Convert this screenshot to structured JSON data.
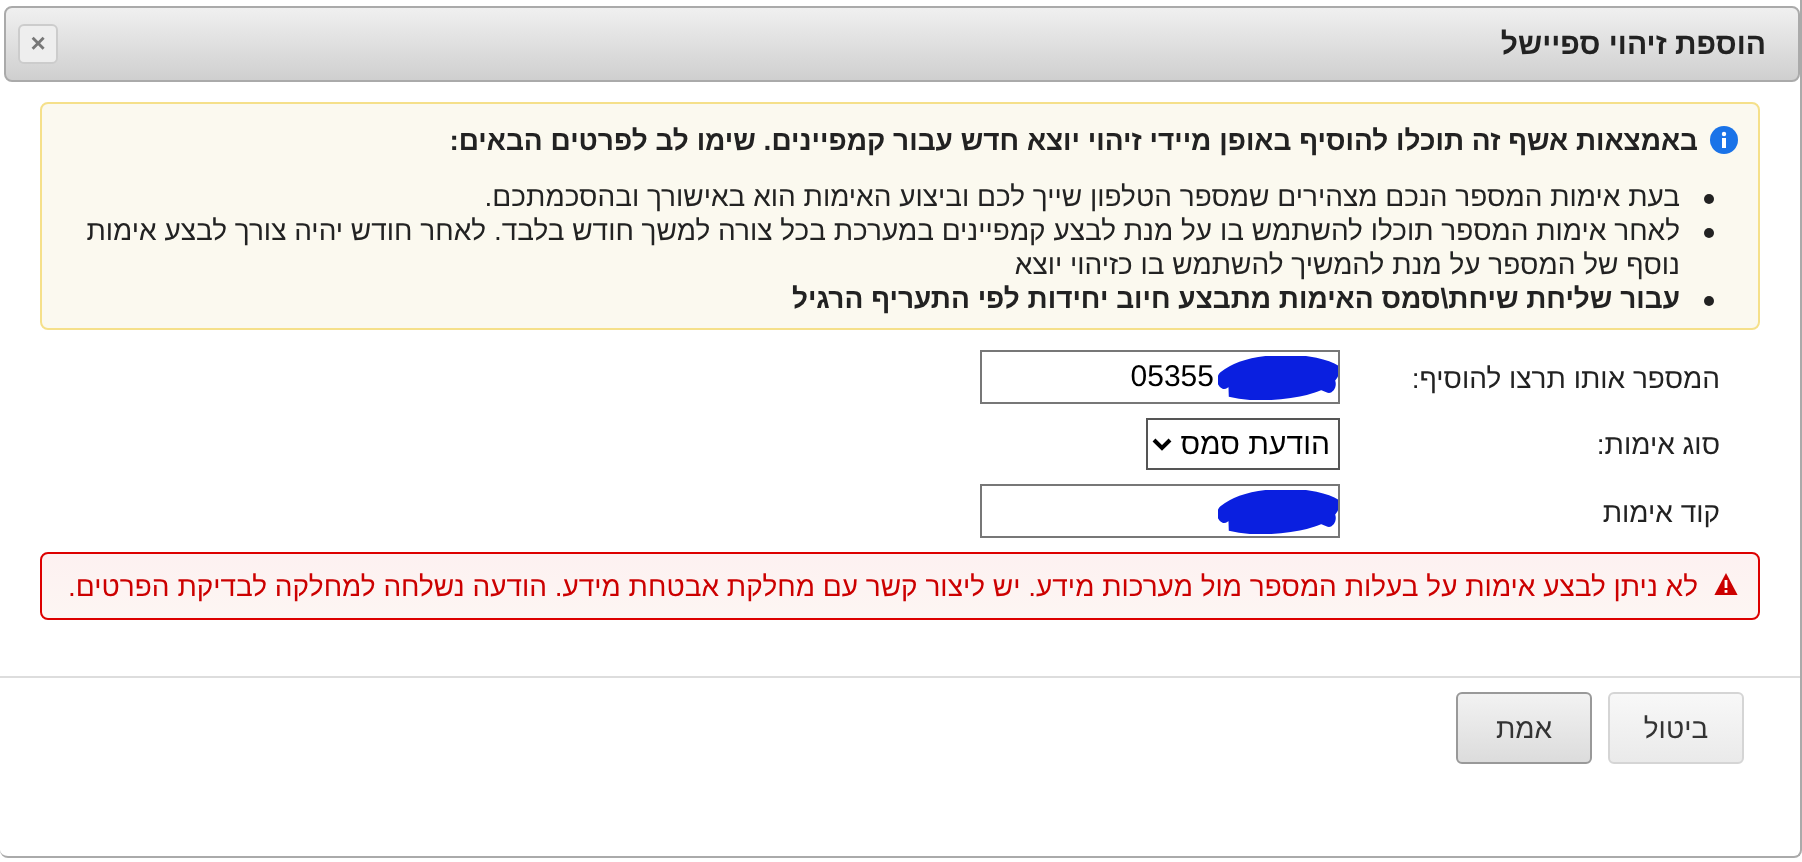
{
  "dialog": {
    "title": "הוספת זיהוי ספיישל",
    "close_label": "×"
  },
  "info": {
    "heading": "באמצאות אשף זה תוכלו להוסיף באופן מיידי זיהוי יוצא חדש עבור קמפיינים. שימו לב לפרטים הבאים:",
    "items": [
      {
        "text": "בעת אימות המספר הנכם מצהירים שמספר הטלפון שייך לכם וביצוע האימות הוא באישורך ובהסכמתכם.",
        "bold": false
      },
      {
        "text": "לאחר אימות המספר תוכלו להשתמש בו על מנת לבצע קמפיינים במערכת בכל צורה למשך חודש בלבד. לאחר חודש יהיה צורך לבצע אימות נוסף של המספר על מנת להמשיך להשתמש בו כזיהוי יוצא",
        "bold": false
      },
      {
        "text": "עבור שליחת שיחת\\סמס האימות מתבצע חיוב יחידות לפי התעריף הרגיל",
        "bold": true
      }
    ]
  },
  "form": [
    {
      "kind": "text",
      "label": "המספר אותו תרצו להוסיף:",
      "value": "05355",
      "redacted": true
    },
    {
      "kind": "select",
      "label": "סוג אימות:",
      "value": "הודעת סמס"
    },
    {
      "kind": "text",
      "label": "קוד אימות",
      "redacted": true
    }
  ],
  "error": "לא ניתן לבצע אימות על בעלות המספר מול מערכות מידע. יש ליצור קשר עם מחלקת אבטחת מידע. הודעה נשלחה למחלקה לבדיקת הפרטים.",
  "buttons": [
    {
      "label": "ביטול",
      "focused": false
    },
    {
      "label": "אמת",
      "focused": true
    }
  ]
}
